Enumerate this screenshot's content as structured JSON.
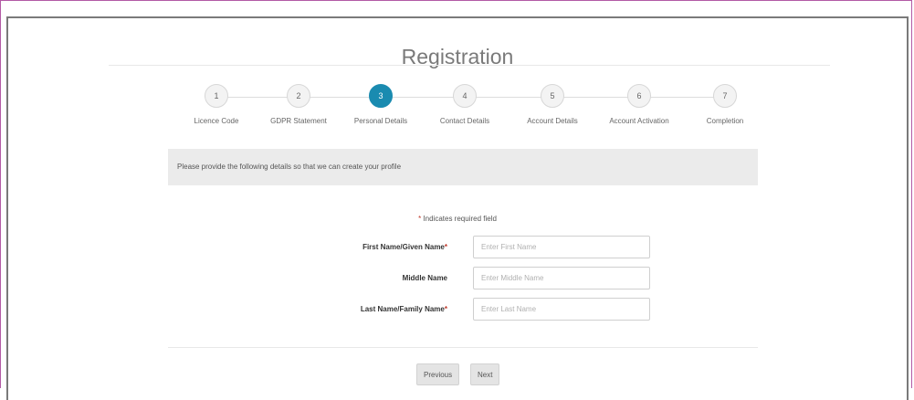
{
  "page": {
    "title": "Registration"
  },
  "steps": [
    {
      "number": "1",
      "label": "Licence Code",
      "active": false
    },
    {
      "number": "2",
      "label": "GDPR Statement",
      "active": false
    },
    {
      "number": "3",
      "label": "Personal Details",
      "active": true
    },
    {
      "number": "4",
      "label": "Contact Details",
      "active": false
    },
    {
      "number": "5",
      "label": "Account Details",
      "active": false
    },
    {
      "number": "6",
      "label": "Account Activation",
      "active": false
    },
    {
      "number": "7",
      "label": "Completion",
      "active": false
    }
  ],
  "info": {
    "text": "Please provide the following details so that we can create your profile"
  },
  "form": {
    "required_star": "*",
    "required_note": " Indicates required field",
    "first_name": {
      "label": "First Name/Given Name",
      "required": "*",
      "placeholder": "Enter First Name",
      "value": ""
    },
    "middle_name": {
      "label": "Middle Name",
      "placeholder": "Enter Middle Name",
      "value": ""
    },
    "last_name": {
      "label": "Last Name/Family Name",
      "required": "*",
      "placeholder": "Enter Last Name",
      "value": ""
    }
  },
  "buttons": {
    "previous": "Previous",
    "next": "Next"
  },
  "colors": {
    "active_step": "#1a8bb0",
    "frame_border": "#7a7a7a",
    "outer_border": "#b25aa6",
    "info_bar_bg": "#ebebeb"
  }
}
